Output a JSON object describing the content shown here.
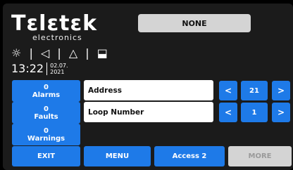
{
  "brand": {
    "name": "Tεlεtεk",
    "sub": "electronics"
  },
  "status_icons": [
    "☼",
    "◁",
    "△",
    "⬓"
  ],
  "clock": {
    "time": "13:22",
    "date_line1": "02.07.",
    "date_line2": "2021"
  },
  "top_status": "NONE",
  "counters": [
    {
      "count": "0",
      "label": "Alarms"
    },
    {
      "count": "0",
      "label": "Faults"
    },
    {
      "count": "0",
      "label": "Warnings"
    }
  ],
  "fields": {
    "address": {
      "label": "Address",
      "value": "21"
    },
    "loop": {
      "label": "Loop Number",
      "value": "1"
    }
  },
  "arrows": {
    "left": "<",
    "right": ">"
  },
  "bottom": {
    "exit": "EXIT",
    "menu": "MENU",
    "access": "Access 2",
    "more": "MORE"
  },
  "colors": {
    "accent": "#1e7ae8",
    "panel": "#1b1b1b",
    "disabled": "#d4d4d4"
  }
}
